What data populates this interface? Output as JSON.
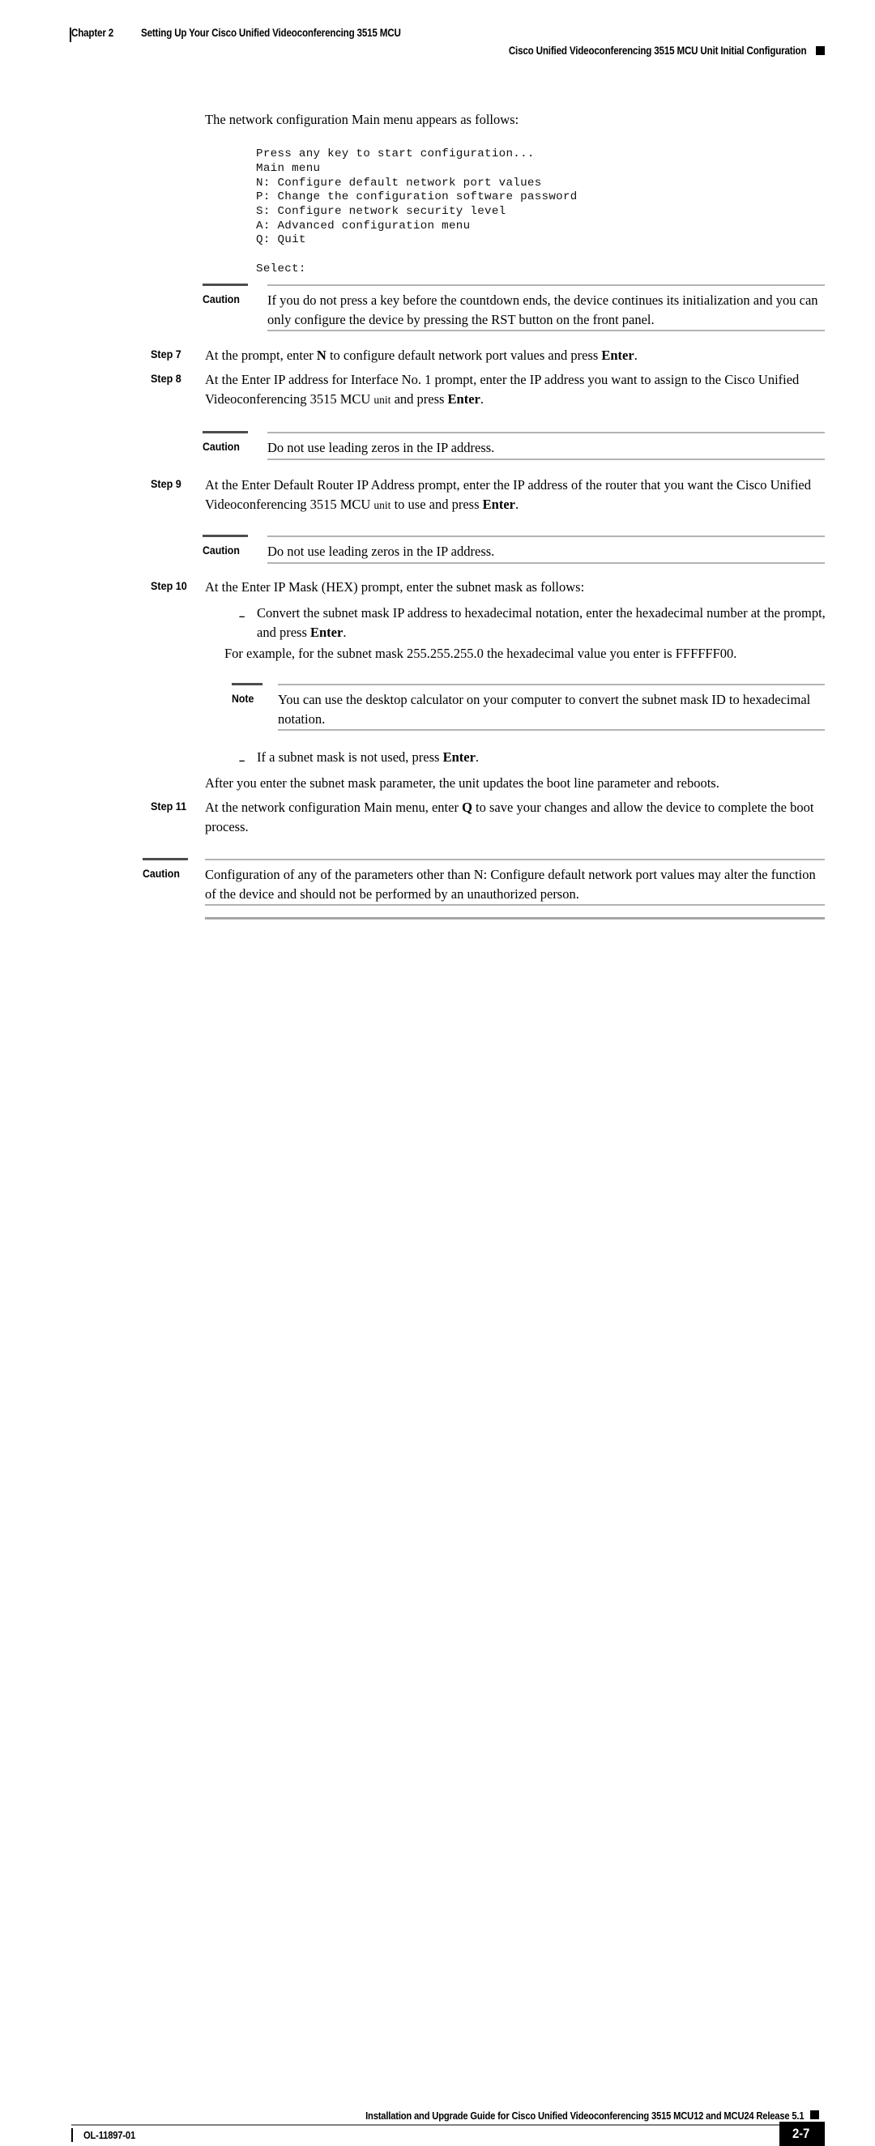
{
  "header": {
    "chapter": "Chapter 2",
    "chapter_title": "Setting Up Your Cisco Unified Videoconferencing 3515 MCU",
    "section_title": "Cisco Unified Videoconferencing 3515 MCU Unit Initial Configuration"
  },
  "body": {
    "intro": "The network configuration Main menu appears as follows:",
    "code_block": "Press any key to start configuration...\nMain menu\nN: Configure default network port values\nP: Change the configuration software password\nS: Configure network security level\nA: Advanced configuration menu\nQ: Quit\n\nSelect:",
    "caution_1": {
      "label": "Caution",
      "text": "If you do not press a key before the countdown ends, the device continues its initialization and you can only configure the device by pressing the RST button on the front panel."
    },
    "step_7": {
      "label": "Step 7",
      "text_a": "At the prompt, enter ",
      "key_n": "N",
      "text_b": " to configure default network port values and press ",
      "key_enter": "Enter",
      "text_c": "."
    },
    "step_8": {
      "label": "Step 8",
      "text_a": "At the Enter IP address for Interface No. 1 prompt, enter the IP address you want to assign to the Cisco Unified Videoconferencing 3515 MCU ",
      "unit": "unit",
      "text_b": " and press ",
      "key_enter": "Enter",
      "text_c": "."
    },
    "caution_2": {
      "label": "Caution",
      "text": "Do not use leading zeros in the IP address."
    },
    "step_9": {
      "label": "Step 9",
      "text_a": "At the Enter Default Router IP Address prompt, enter the IP address of the router that you want the Cisco Unified Videoconferencing 3515 MCU ",
      "unit": "unit",
      "text_b": " to use and press ",
      "key_enter": "Enter",
      "text_c": "."
    },
    "caution_3": {
      "label": "Caution",
      "text": "Do not use leading zeros in the IP address."
    },
    "step_10": {
      "label": "Step 10",
      "text": "At the Enter IP Mask (HEX) prompt, enter the subnet mask as follows:"
    },
    "bullet_1": {
      "dash": "–",
      "text_a": "Convert the subnet mask IP address to hexadecimal notation, enter the hexadecimal number at the prompt, and press ",
      "key_enter": "Enter",
      "text_b": "."
    },
    "example": "For example, for the subnet mask 255.255.255.0 the hexadecimal value you enter is FFFFFF00.",
    "note_1": {
      "label": "Note",
      "text": "You can use the desktop calculator on your computer to convert the subnet mask ID to hexadecimal notation."
    },
    "bullet_2": {
      "dash": "–",
      "text_a": "If a subnet mask is not used, press ",
      "key_enter": "Enter",
      "text_b": "."
    },
    "after_text": "After you enter the subnet mask parameter, the unit updates the boot line parameter and reboots.",
    "step_11": {
      "label": "Step 11",
      "text_a": "At the network configuration Main menu, enter ",
      "key_q": "Q",
      "text_b": " to save your changes and allow the device to complete the boot process."
    },
    "caution_4": {
      "label": "Caution",
      "text": "Configuration of any of the parameters other than N: Configure default network port values may alter the function of the device and should not be performed by an unauthorized person."
    }
  },
  "footer": {
    "guide_title": "Installation and Upgrade Guide for Cisco Unified Videoconferencing 3515 MCU12 and MCU24 Release 5.1",
    "doc_id": "OL-11897-01",
    "page_number": "2-7"
  }
}
